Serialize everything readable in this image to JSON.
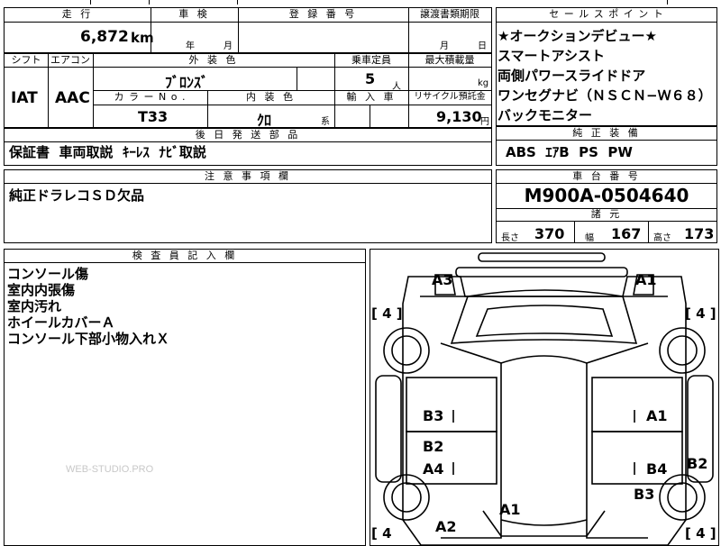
{
  "header": {
    "mileage_label": "走 行",
    "inspection_label": "車 検",
    "registration_label": "登 録 番 号",
    "transfer_label": "譲渡書類期限",
    "mileage_value": "6,872",
    "mileage_unit": "km",
    "inspection_year_unit": "年",
    "inspection_month_unit": "月",
    "transfer_month_unit": "月",
    "transfer_day_unit": "日"
  },
  "specs": {
    "shift_label": "シフト",
    "aircon_label": "エアコン",
    "exterior_label": "外 装 色",
    "capacity_label": "乗車定員",
    "load_label": "最大積載量",
    "shift_value": "IAT",
    "aircon_value": "AAC",
    "exterior_value": "ﾌﾞﾛﾝｽﾞ",
    "capacity_value": "5",
    "capacity_unit": "人",
    "load_unit": "kg",
    "color_no_label": "カ ラ ー N o .",
    "interior_label": "内 装 色",
    "import_label": "輸 入 車",
    "recycle_label": "リサイクル預託金",
    "color_no_value": "T33",
    "interior_value": "ｸﾛ",
    "interior_suffix": "系",
    "recycle_value": "9,130",
    "recycle_unit": "円"
  },
  "selling_points": {
    "label": "セ ー ル ス ポ イ ン ト",
    "items": [
      "★オークションデビュー★",
      "スマートアシスト",
      "両側パワースライドドア",
      "ワンセグナビ（ＮＳＣＮ−Ｗ６８）",
      "バックモニター"
    ]
  },
  "options": {
    "label": "純 正 装 備",
    "value": "ABS  ｴｱB  PS  PW"
  },
  "aftermarket": {
    "label": "後 日 発 送 部 品",
    "value": "保証書  車両取説  ｷｰﾚｽ  ﾅﾋﾞ取説"
  },
  "notes": {
    "label": "注 意 事 項 欄",
    "value": "純正ドラレコＳＤ欠品"
  },
  "chassis": {
    "label": "車 台 番 号",
    "value": "M900A-0504640"
  },
  "dimensions": {
    "label": "諸 元",
    "length_label": "長さ",
    "length_value": "370",
    "width_label": "幅",
    "width_value": "167",
    "height_label": "高さ",
    "height_value": "173"
  },
  "inspector": {
    "label": "検 査 員 記 入 欄",
    "items": [
      "コンソール傷",
      "室内内張傷",
      "室内汚れ",
      "ホイールカバーＡ",
      "コンソール下部小物入れＸ"
    ]
  },
  "watermark": "WEB-STUDIO.PRO",
  "diagram": {
    "tire_tl": "[ 4 ]",
    "tire_tr": "[ 4 ]",
    "tire_bl": "[ 4",
    "tire_br": "[ 4 ]",
    "marks": {
      "a3_top": "A3",
      "a1_top": "A1",
      "b3_left": "B3",
      "a1_right": "A1",
      "b2_left": "B2",
      "a4_left": "A4",
      "b4_right": "B4",
      "b2_right": "B2",
      "b3_right": "B3",
      "a1_bottom": "A1",
      "a2_bottom": "A2"
    }
  }
}
